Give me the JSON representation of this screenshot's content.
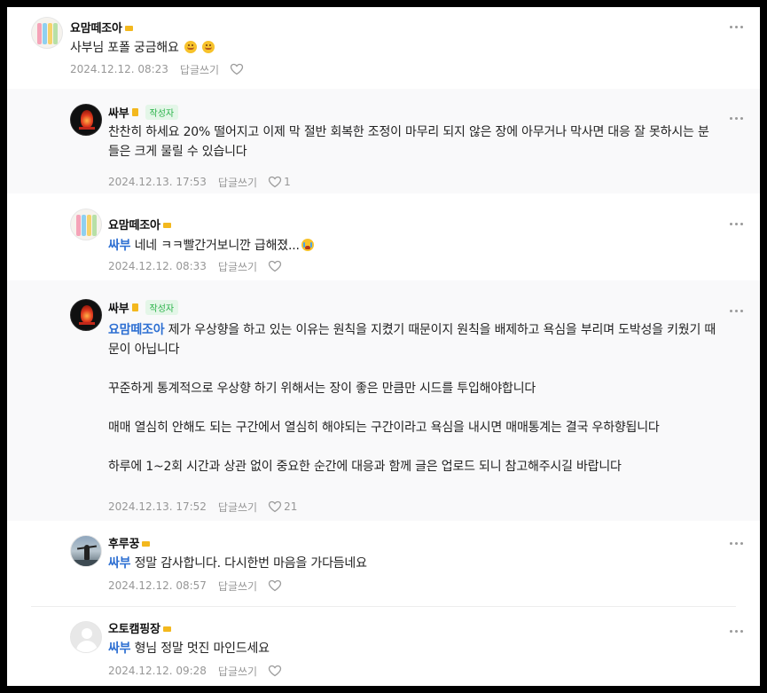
{
  "comments": [
    {
      "nickname": "요맘떼조아",
      "is_author": false,
      "text": "사부님 포폴 궁금해요",
      "emojis": [
        "smiling-face",
        "smiling-face"
      ],
      "date": "2024.12.12. 08:23",
      "reply_label": "답글쓰기",
      "likes": ""
    },
    {
      "nickname": "싸부",
      "is_author": true,
      "author_badge": "작성자",
      "text": "찬찬히 하세요 20% 떨어지고 이제 막 절반 회복한 조정이 마무리 되지 않은 장에 아무거나 막사면 대응 잘 못하시는 분들은 크게 물릴 수 있습니다",
      "date": "2024.12.13. 17:53",
      "reply_label": "답글쓰기",
      "likes": "1"
    },
    {
      "nickname": "요맘떼조아",
      "is_author": false,
      "mention": "싸부",
      "text": " 네네 ㅋㅋ빨간거보니깐 급해졌...",
      "emojis": [
        "crying-face"
      ],
      "date": "2024.12.12. 08:33",
      "reply_label": "답글쓰기",
      "likes": ""
    },
    {
      "nickname": "싸부",
      "is_author": true,
      "author_badge": "작성자",
      "mention": "요맘떼조아",
      "text": " 제가 우상향을 하고 있는 이유는 원칙을 지켰기 때문이지 원칙을 배제하고 욕심을 부리며 도박성을 키웠기 때문이 아닙니다\n\n꾸준하게 통계적으로 우상향 하기 위해서는 장이 좋은 만큼만 시드를 투입해야합니다\n\n매매 열심히 안해도 되는 구간에서 열심히 해야되는 구간이라고 욕심을 내시면 매매통계는 결국 우하향됩니다\n\n하루에 1~2회 시간과 상관 없이 중요한 순간에 대응과 함께 글은 업로드 되니 참고해주시길 바랍니다",
      "date": "2024.12.13. 17:52",
      "reply_label": "답글쓰기",
      "likes": "21"
    },
    {
      "nickname": "후루꿍",
      "is_author": false,
      "mention": "싸부",
      "text": " 정말 감사합니다. 다시한번 마음을 가다듬네요",
      "date": "2024.12.12. 08:57",
      "reply_label": "답글쓰기",
      "likes": ""
    },
    {
      "nickname": "오토캠핑장",
      "is_author": false,
      "mention": "싸부",
      "text": " 형님 정말 멋진 마인드세요",
      "date": "2024.12.12. 09:28",
      "reply_label": "답글쓰기",
      "likes": ""
    }
  ],
  "colors": {
    "mention": "#2d6fd2",
    "author_badge": "#2bb34a",
    "author_bg": "#f9f9fa",
    "meta": "#979797"
  },
  "icons": {
    "like": "heart-icon",
    "more": "more-options-icon"
  }
}
